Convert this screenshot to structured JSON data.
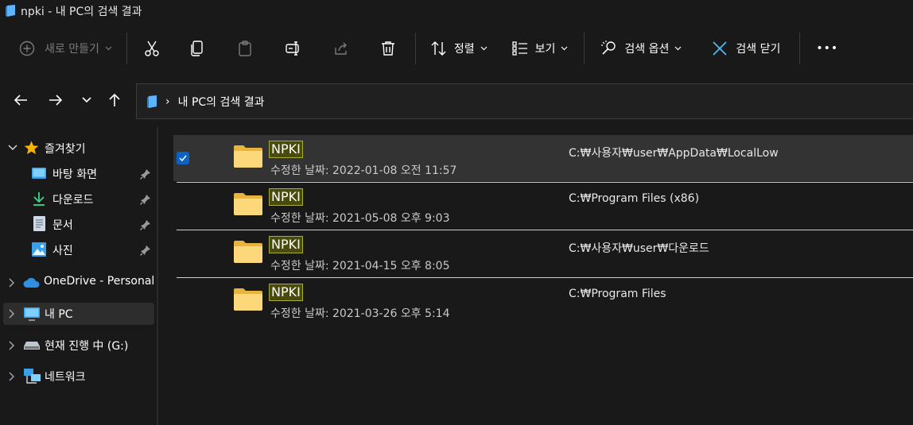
{
  "window": {
    "title": "npki - 내 PC의 검색 결과"
  },
  "toolbar": {
    "new_label": "새로 만들기",
    "sort_label": "정렬",
    "view_label": "보기",
    "search_options_label": "검색 옵션",
    "close_search_label": "검색 닫기",
    "more_label": "•••"
  },
  "address": {
    "separator": "›",
    "crumb": "내 PC의 검색 결과"
  },
  "sidebar": {
    "quick_access": {
      "label": "즐겨찾기",
      "items": [
        {
          "label": "바탕 화면",
          "icon": "desktop-icon",
          "pinned": true
        },
        {
          "label": "다운로드",
          "icon": "download-icon",
          "pinned": true
        },
        {
          "label": "문서",
          "icon": "document-icon",
          "pinned": true
        },
        {
          "label": "사진",
          "icon": "picture-icon",
          "pinned": true
        }
      ]
    },
    "onedrive": {
      "label": "OneDrive - Personal"
    },
    "this_pc": {
      "label": "내 PC"
    },
    "drive": {
      "label": "현재 진행 中 (G:)"
    },
    "network": {
      "label": "네트워크"
    }
  },
  "results": [
    {
      "name": "NPKI",
      "meta": "수정한 날짜: 2022-01-08 오전 11:57",
      "path": "C:₩사용자₩user₩AppData₩LocalLow",
      "selected": true
    },
    {
      "name": "NPKI",
      "meta": "수정한 날짜: 2021-05-08 오후 9:03",
      "path": "C:₩Program Files (x86)",
      "selected": false
    },
    {
      "name": "NPKI",
      "meta": "수정한 날짜: 2021-04-15 오후 8:05",
      "path": "C:₩사용자₩user₩다운로드",
      "selected": false
    },
    {
      "name": "NPKI",
      "meta": "수정한 날짜: 2021-03-26 오후 5:14",
      "path": "C:₩Program Files",
      "selected": false
    }
  ],
  "colors": {
    "background": "#191919",
    "selection": "#333333",
    "highlight_fill": "#494b0c",
    "highlight_border": "#a9ac36",
    "accent": "#0a64c8",
    "folder": "#f8d775"
  }
}
